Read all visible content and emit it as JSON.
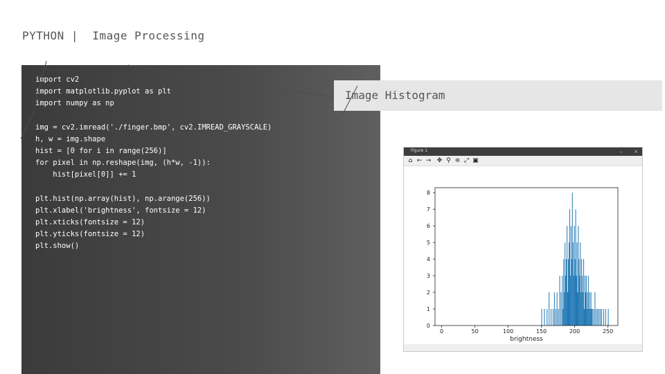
{
  "slide": {
    "title": "PYTHON |  Image Processing",
    "histogram_label": "Image Histogram"
  },
  "code": {
    "lines": [
      "import cv2",
      "import matplotlib.pyplot as plt",
      "import numpy as np",
      "",
      "img = cv2.imread('./finger.bmp', cv2.IMREAD_GRAYSCALE)",
      "h, w = img.shape",
      "hist = [0 for i in range(256)]",
      "for pixel in np.reshape(img, (h*w, -1)):",
      "    hist[pixel[0]] += 1",
      "",
      "plt.hist(np.array(hist), np.arange(256))",
      "plt.xlabel('brightness', fontsize = 12)",
      "plt.xticks(fontsize = 12)",
      "plt.yticks(fontsize = 12)",
      "plt.show()"
    ]
  },
  "plot_window": {
    "title": "Figure 1",
    "controls": [
      "–",
      "×"
    ],
    "toolbar_icons": [
      "home-icon",
      "back-icon",
      "forward-icon",
      "pan-icon",
      "zoom-icon",
      "configure-icon",
      "edit-axis-icon",
      "save-icon"
    ],
    "toolbar_glyphs": [
      "⌂",
      "←",
      "→",
      "✥",
      "⚲",
      "≡",
      "⤢",
      "▣"
    ]
  },
  "chart_data": {
    "type": "bar",
    "title": "",
    "xlabel": "brightness",
    "ylabel": "",
    "xlim": [
      -10,
      265
    ],
    "ylim": [
      0,
      8.3
    ],
    "xticks": [
      0,
      50,
      100,
      150,
      200,
      250
    ],
    "yticks": [
      0,
      1,
      2,
      3,
      4,
      5,
      6,
      7,
      8
    ],
    "bar_color": "#1f77b4",
    "x": [
      150,
      154,
      158,
      161,
      164,
      167,
      169,
      171,
      173,
      175,
      177,
      179,
      181,
      182,
      183,
      184,
      185,
      186,
      187,
      188,
      189,
      190,
      191,
      192,
      193,
      194,
      195,
      196,
      197,
      198,
      199,
      200,
      201,
      202,
      203,
      204,
      205,
      206,
      207,
      208,
      209,
      210,
      211,
      212,
      213,
      214,
      215,
      216,
      217,
      218,
      219,
      220,
      221,
      222,
      223,
      224,
      225,
      226,
      228,
      230,
      232,
      234,
      236,
      238,
      240,
      243,
      246,
      250
    ],
    "y": [
      1,
      1,
      1,
      2,
      1,
      1,
      2,
      1,
      2,
      1,
      3,
      2,
      3,
      1,
      4,
      2,
      5,
      3,
      4,
      6,
      2,
      4,
      5,
      7,
      3,
      6,
      4,
      8,
      5,
      3,
      6,
      4,
      7,
      3,
      5,
      2,
      6,
      4,
      3,
      5,
      2,
      4,
      3,
      2,
      4,
      1,
      3,
      2,
      3,
      1,
      2,
      3,
      1,
      2,
      1,
      2,
      1,
      1,
      1,
      2,
      1,
      1,
      1,
      1,
      1,
      1,
      1,
      1
    ]
  }
}
